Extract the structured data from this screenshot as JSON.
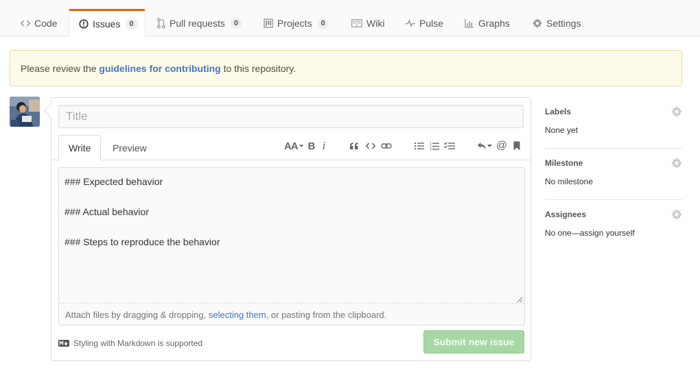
{
  "tabs": [
    {
      "label": "Code",
      "icon": "code-icon"
    },
    {
      "label": "Issues",
      "icon": "issue-icon",
      "counter": "0",
      "selected": true
    },
    {
      "label": "Pull requests",
      "icon": "pull-request-icon",
      "counter": "0"
    },
    {
      "label": "Projects",
      "icon": "project-icon",
      "counter": "0"
    },
    {
      "label": "Wiki",
      "icon": "book-icon"
    },
    {
      "label": "Pulse",
      "icon": "pulse-icon"
    },
    {
      "label": "Graphs",
      "icon": "graph-icon"
    },
    {
      "label": "Settings",
      "icon": "gear-icon"
    }
  ],
  "flash": {
    "prefix": "Please review the ",
    "link": "guidelines for contributing",
    "suffix": " to this repository."
  },
  "composer": {
    "title_placeholder": "Title",
    "write_tab": "Write",
    "preview_tab": "Preview",
    "toolbar": {
      "heading": "AA",
      "bold": "B",
      "italic": "i",
      "mention": "@"
    },
    "body": "### Expected behavior\n\n### Actual behavior\n\n### Steps to reproduce the behavior",
    "attach_prefix": "Attach files by dragging & dropping, ",
    "attach_link": "selecting them",
    "attach_suffix": ", or pasting from the clipboard.",
    "markdown_note": "Styling with Markdown is supported",
    "submit_label": "Submit new issue"
  },
  "sidebar": {
    "labels": {
      "heading": "Labels",
      "value": "None yet"
    },
    "milestone": {
      "heading": "Milestone",
      "value": "No milestone"
    },
    "assignees": {
      "heading": "Assignees",
      "value": "No one—assign yourself"
    }
  },
  "colors": {
    "accent_tab": "#e36209",
    "link": "#4078c0",
    "flash_bg": "#fffbea",
    "submit_disabled": "#a6d8a4"
  }
}
